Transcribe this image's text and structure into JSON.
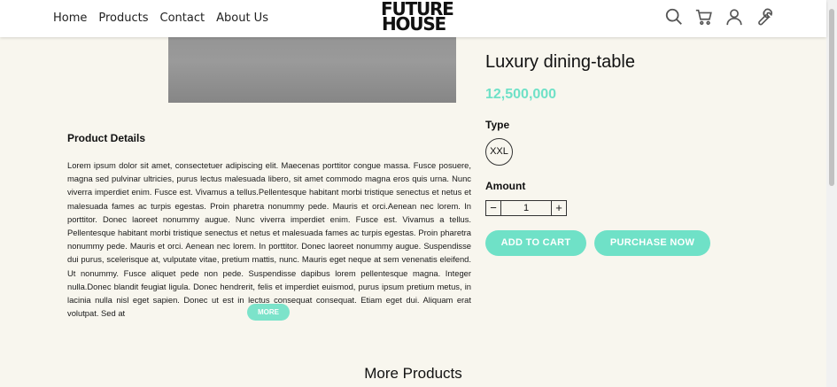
{
  "nav": {
    "items": [
      {
        "label": "Home"
      },
      {
        "label": "Products"
      },
      {
        "label": "Contact"
      },
      {
        "label": "About Us"
      }
    ]
  },
  "logo": {
    "line1": "FUTURE",
    "line2": "HOUSE"
  },
  "header_icons": [
    "search-icon",
    "cart-icon",
    "user-icon",
    "wrench-icon"
  ],
  "product": {
    "name": "Luxury dining-table",
    "price": "12,500,000",
    "type_label": "Type",
    "type_option": "XXL",
    "amount_label": "Amount",
    "quantity": "1",
    "minus_symbol": "−",
    "plus_symbol": "+",
    "add_to_cart": "ADD TO CART",
    "purchase_now": "PURCHASE NOW"
  },
  "details": {
    "title": "Product Details",
    "text": "Lorem ipsum dolor sit amet, consectetuer adipiscing elit. Maecenas porttitor congue massa. Fusce posuere, magna sed pulvinar ultricies, purus lectus malesuada libero, sit amet commodo magna eros quis urna. Nunc viverra imperdiet enim. Fusce est. Vivamus a tellus.Pellentesque habitant morbi tristique senectus et netus et malesuada fames ac turpis egestas. Proin pharetra nonummy pede. Mauris et orci.Aenean nec lorem. In porttitor. Donec laoreet nonummy augue. Nunc viverra imperdiet enim. Fusce est. Vivamus a tellus. Pellentesque habitant morbi tristique senectus et netus et malesuada fames ac turpis egestas. Proin pharetra nonummy pede. Mauris et orci. Aenean nec lorem. In porttitor. Donec laoreet nonummy augue. Suspendisse dui purus, scelerisque at, vulputate vitae, pretium mattis, nunc. Mauris eget neque at sem venenatis eleifend. Ut nonummy. Fusce aliquet pede non pede. Suspendisse dapibus lorem pellentesque magna. Integer nulla.Donec blandit feugiat ligula. Donec hendrerit, felis et imperdiet euismod, purus ipsum pretium metus, in lacinia nulla nisl eget sapien. Donec ut est in lectus consequat consequat. Etiam eget dui. Aliquam erat volutpat. Sed at",
    "more_button": "MORE"
  },
  "more_products_title": "More Products",
  "colors": {
    "accent": "#6fe1c7",
    "background": "#f8f6ee",
    "header": "#ffffff"
  }
}
